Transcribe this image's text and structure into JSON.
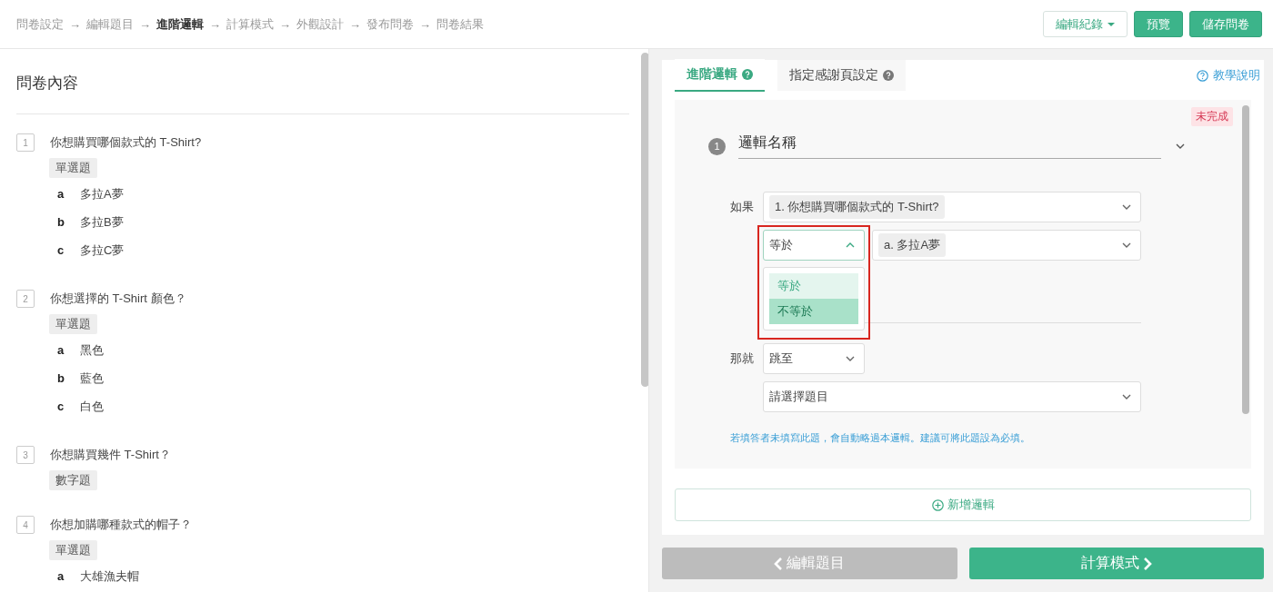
{
  "breadcrumb": {
    "separator": "→",
    "steps": [
      {
        "label": "問卷設定",
        "selected": false
      },
      {
        "label": "編輯題目",
        "selected": false
      },
      {
        "label": "進階邏輯",
        "selected": true
      },
      {
        "label": "計算模式",
        "selected": false
      },
      {
        "label": "外觀設計",
        "selected": false
      },
      {
        "label": "發布問卷",
        "selected": false
      },
      {
        "label": "問卷結果",
        "selected": false
      }
    ]
  },
  "header_buttons": [
    {
      "label": "編輯紀錄",
      "kind": "dropdown"
    },
    {
      "label": "預覽",
      "kind": "primary"
    },
    {
      "label": "儲存問卷",
      "kind": "primary"
    }
  ],
  "questionnaire": {
    "title": "問卷內容",
    "questions": [
      {
        "number": "1",
        "text": "你想購買哪個款式的 T-Shirt?",
        "type": "單選題",
        "options": [
          {
            "letter": "a",
            "label": "多拉A夢"
          },
          {
            "letter": "b",
            "label": "多拉B夢"
          },
          {
            "letter": "c",
            "label": "多拉C夢"
          }
        ]
      },
      {
        "number": "2",
        "text": "你想選擇的 T-Shirt 顏色？",
        "type": "單選題",
        "options": [
          {
            "letter": "a",
            "label": "黑色"
          },
          {
            "letter": "b",
            "label": "藍色"
          },
          {
            "letter": "c",
            "label": "白色"
          }
        ]
      },
      {
        "number": "3",
        "text": "你想購買幾件 T-Shirt？",
        "type": "數字題"
      },
      {
        "number": "4",
        "text": "你想加購哪種款式的帽子？",
        "type": "單選題",
        "options": [
          {
            "letter": "a",
            "label": "大雄漁夫帽"
          }
        ]
      }
    ]
  },
  "logic": {
    "tabs": [
      {
        "label": "進階邏輯",
        "selected": true
      },
      {
        "label": "指定感謝頁設定",
        "selected": false
      }
    ],
    "help_link": "教學說明",
    "rule": {
      "number": "1",
      "name": "邏輯名稱",
      "status": "未完成",
      "if_label": "如果",
      "question": "1. 你想購買哪個款式的 T-Shirt?",
      "operator": {
        "value": "等於",
        "open": true,
        "highlighted": true,
        "options": [
          {
            "label": "等於",
            "selected": true,
            "hovered": false
          },
          {
            "label": "不等於",
            "selected": false,
            "hovered": true
          }
        ]
      },
      "answer": "a. 多拉A夢",
      "then_label": "那就",
      "action": "跳至",
      "target": "請選擇題目",
      "hint": "若填答者未填寫此題，會自動略過本邏輯。建議可將此題設為必填。"
    },
    "add_button": "新增邏輯"
  },
  "footer": {
    "back": "編輯題目",
    "next": "計算模式"
  }
}
